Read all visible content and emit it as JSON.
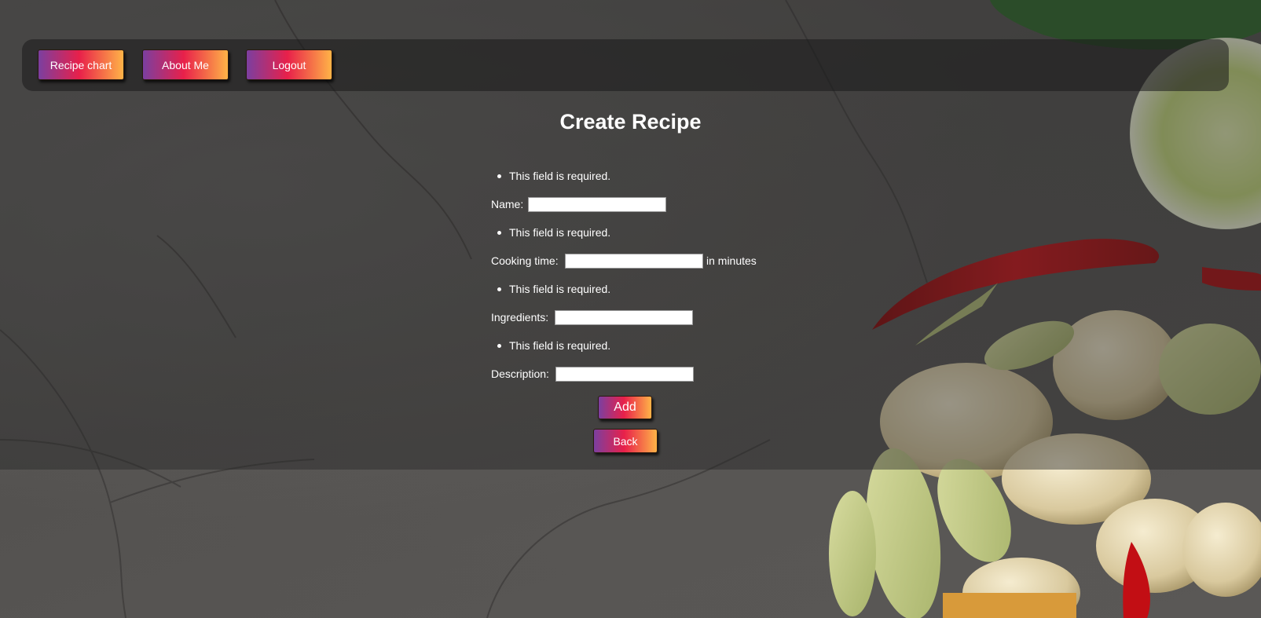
{
  "nav": {
    "recipe_chart": "Recipe chart",
    "about_me": "About Me",
    "logout": "Logout"
  },
  "page_title": "Create Recipe",
  "form": {
    "name": {
      "error": "This field is required.",
      "label": "Name:",
      "value": ""
    },
    "cooking_time": {
      "error": "This field is required.",
      "label": "Cooking time:",
      "value": "",
      "suffix": "in minutes"
    },
    "ingredients": {
      "error": "This field is required.",
      "label": "Ingredients:",
      "value": ""
    },
    "description": {
      "error": "This field is required.",
      "label": "Description:",
      "value": ""
    },
    "add_label": "Add",
    "back_label": "Back"
  },
  "colors": {
    "button_gradient": [
      "#7b3fa0",
      "#e8204a",
      "#ffb347"
    ],
    "background": "#585656"
  }
}
